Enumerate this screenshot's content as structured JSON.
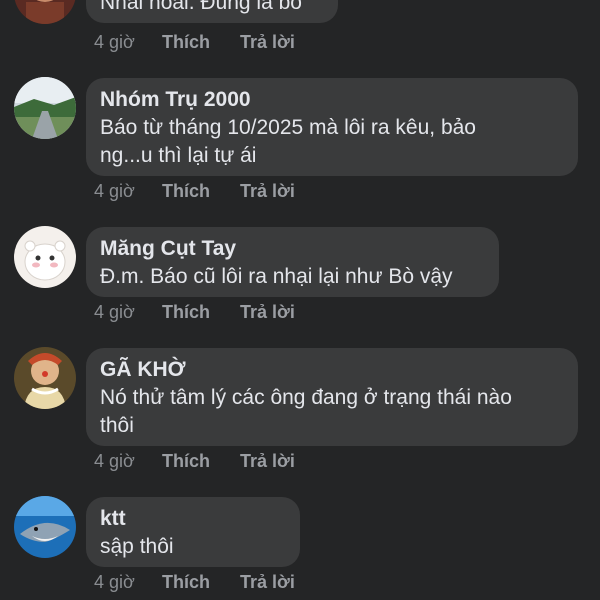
{
  "comments": [
    {
      "author": "",
      "text": "Nhai hoai. Đúng là bò",
      "time": "4 giờ",
      "like_label": "Thích",
      "reply_label": "Trả lời"
    },
    {
      "author": "Nhóm Trụ 2000",
      "text": "Báo từ tháng 10/2025 mà lôi ra kêu, bảo\nng...u thì lại tự ái",
      "time": "4 giờ",
      "like_label": "Thích",
      "reply_label": "Trả lời"
    },
    {
      "author": "Măng Cụt Tay",
      "text": "Đ.m. Báo cũ lôi ra nhại lại như Bò vậy",
      "time": "4 giờ",
      "like_label": "Thích",
      "reply_label": "Trả lời"
    },
    {
      "author": "GÃ KHỜ",
      "text": "Nó thử tâm lý các ông đang ở trạng thái nào\nthôi",
      "time": "4 giờ",
      "like_label": "Thích",
      "reply_label": "Trả lời"
    },
    {
      "author": "ktt",
      "text": "sập thôi",
      "time": "4 giờ",
      "like_label": "Thích",
      "reply_label": "Trả lời"
    }
  ],
  "colors": {
    "background": "#242526",
    "bubble": "#3a3b3c",
    "text": "#e4e6eb",
    "meta": "#8a8d91"
  }
}
